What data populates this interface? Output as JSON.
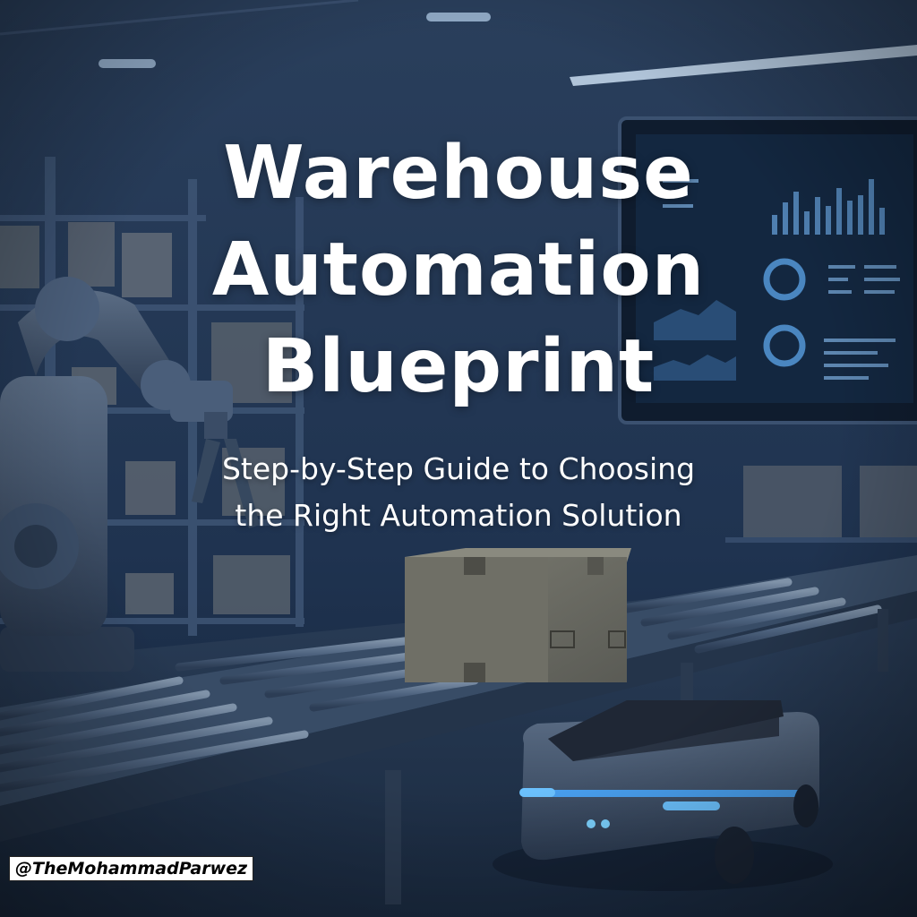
{
  "title": {
    "line1": "Warehouse",
    "line2": "Automation",
    "line3": "Blueprint"
  },
  "subtitle": {
    "line1": "Step-by-Step Guide to Choosing",
    "line2": "the Right Automation Solution"
  },
  "watermark": "@TheMohammadParwez",
  "colors": {
    "background": "#1a2c44",
    "text": "#ffffff",
    "accent_light": "#4aa8ff"
  }
}
